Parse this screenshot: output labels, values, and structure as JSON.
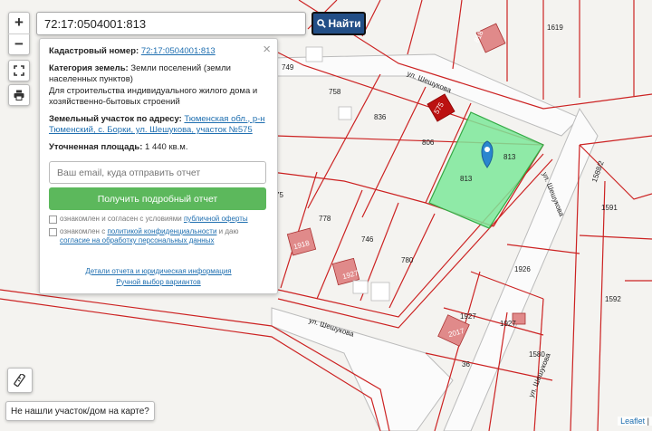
{
  "search": {
    "value": "72:17:0504001:813",
    "button_label": "Найти"
  },
  "zoom": {
    "in": "+",
    "out": "−"
  },
  "popup": {
    "cadastral_label": "Кадастровый номер:",
    "cadastral_value": "72:17:0504001:813",
    "category_label": "Категория земель:",
    "category_value": "Земли поселений (земли населенных пунктов)",
    "usage_value": "Для строительства индивидуального жилого дома и хозяйственно-бытовых строений",
    "address_label": "Земельный участок по адресу:",
    "address_value": "Тюменская обл., р-н Тюменский, с. Борки, ул. Шешукова, участок №575",
    "area_label": "Уточненная площадь:",
    "area_value": "1 440 кв.м.",
    "email_placeholder": "Ваш email, куда отправить отчет",
    "report_button": "Получить подробный отчет",
    "agree1_text": "ознакомлен и согласен с условиями",
    "agree1_link": "публичной оферты",
    "agree2_text": "ознакомлен с",
    "agree2_link": "политикой конфиденциальности",
    "agree2_text2": "и даю",
    "agree2_link2": "согласие на обработку персональных данных",
    "link_details": "Детали отчета и юридическая информация",
    "link_manual": "Ручной выбор вариантов"
  },
  "not_found_button": "Не нашли участок/дом на карте?",
  "attribution": {
    "leaflet": "Leaflet",
    "sep": "|"
  },
  "map": {
    "parcel_labels": [
      "813",
      "813",
      "806",
      "836",
      "758",
      "749",
      "778",
      "746",
      "780",
      "1926",
      "1927",
      "1927",
      "1580",
      "1591",
      "1592",
      "1619",
      "1588/2",
      "1918",
      "36",
      "75"
    ],
    "building_labels": [
      "818",
      "1918",
      "575",
      "2017",
      "1927"
    ],
    "street_labels": [
      "ул. Шешукова",
      "ул. Шешукова",
      "ул. Шешукова",
      "ул. Шешукова"
    ]
  },
  "colors": {
    "parcel_line": "#cc2222",
    "selected_fill": "#7ce89a",
    "marker": "#2a86cf",
    "button_primary": "#224e86",
    "button_report": "#5cb85c",
    "building": "#e08a8a"
  }
}
